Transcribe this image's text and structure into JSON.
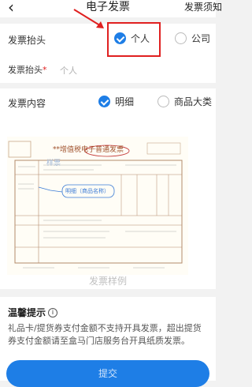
{
  "nav": {
    "title": "电子发票",
    "right": "发票须知"
  },
  "header_section": {
    "label": "发票抬头",
    "options": [
      "个人",
      "公司"
    ],
    "selected": "个人",
    "title_field_label": "发票抬头",
    "title_field_placeholder": "个人"
  },
  "content_section": {
    "label": "发票内容",
    "options": [
      "明细",
      "商品大类"
    ],
    "selected": "明细"
  },
  "invoice_sample": {
    "heading": "**增值税电子普通发票",
    "badge": "样票",
    "note": "明细（商品名称）",
    "caption": "发票样例"
  },
  "tips": {
    "title": "温馨提示",
    "text": "礼品卡/提货券支付金额不支持开具发票，超出提货券支付金额请至盒马门店服务台开具纸质发票。"
  },
  "footer": {
    "button_label": "提交"
  },
  "colors": {
    "accent": "#1e7ee6",
    "annotation": "#e02020"
  }
}
